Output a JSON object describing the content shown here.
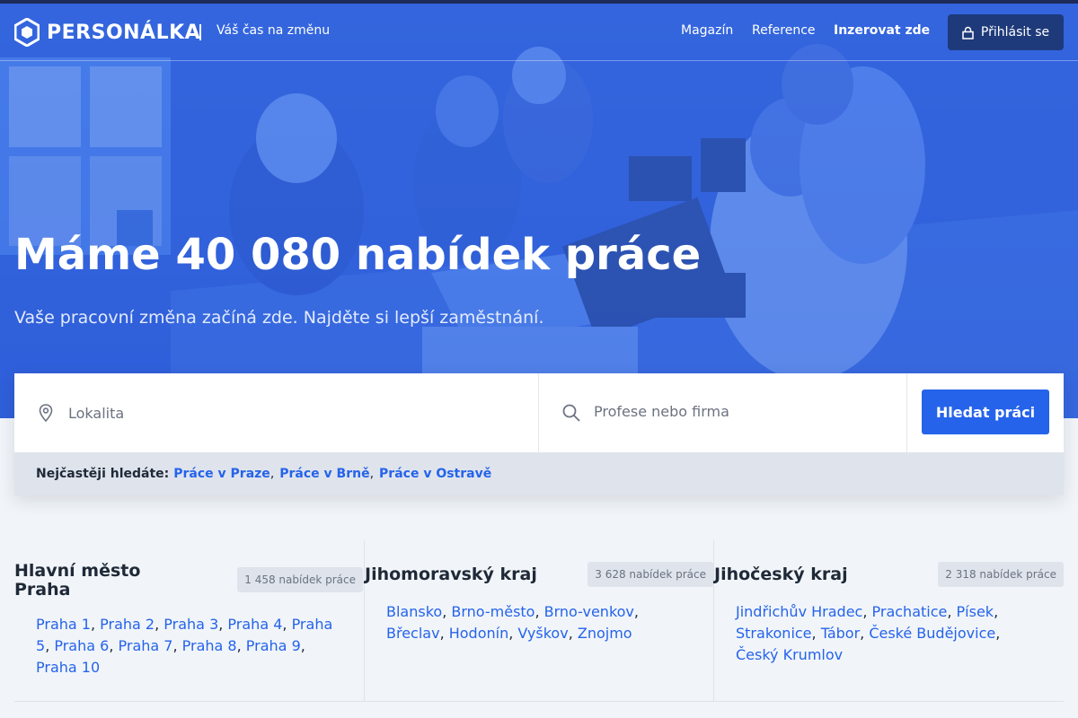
{
  "header": {
    "logo_text": "PERSONÁLKA",
    "tagline": "Váš čas na změnu",
    "nav": [
      "Magazín",
      "Reference",
      "Inzerovat zde"
    ],
    "login_label": "Přihlásit se"
  },
  "hero": {
    "title": "Máme 40 080 nabídek práce",
    "subtitle": "Vaše pracovní změna začíná zde. Najděte si lepší zaměstnání."
  },
  "search": {
    "location_placeholder": "Lokalita",
    "profession_placeholder": "Profese nebo firma",
    "button_label": "Hledat práci"
  },
  "popular": {
    "label": "Nejčastěji hledáte:",
    "links": [
      "Práce v Praze",
      "Práce v Brně",
      "Práce v Ostravě"
    ]
  },
  "regions": [
    {
      "title": "Hlavní město Praha",
      "count": "1 458 nabídek práce",
      "cities": [
        "Praha 1",
        "Praha 2",
        "Praha 3",
        "Praha 4",
        "Praha 5",
        "Praha 6",
        "Praha 7",
        "Praha 8",
        "Praha 9",
        "Praha 10"
      ]
    },
    {
      "title": "Jihomoravský kraj",
      "count": "3 628 nabídek práce",
      "cities": [
        "Blansko",
        "Brno-město",
        "Brno-venkov",
        "Břeclav",
        "Hodonín",
        "Vyškov",
        "Znojmo"
      ]
    },
    {
      "title": "Jihočeský kraj",
      "count": "2 318 nabídek práce",
      "cities": [
        "Jindřichův Hradec",
        "Prachatice",
        "Písek",
        "Strakonice",
        "Tábor",
        "České Budějovice",
        "Český Krumlov"
      ]
    }
  ],
  "colors": {
    "brand_blue": "#2563eb",
    "hero_overlay": "#3566e0",
    "login_bg": "#1e3a7a"
  }
}
